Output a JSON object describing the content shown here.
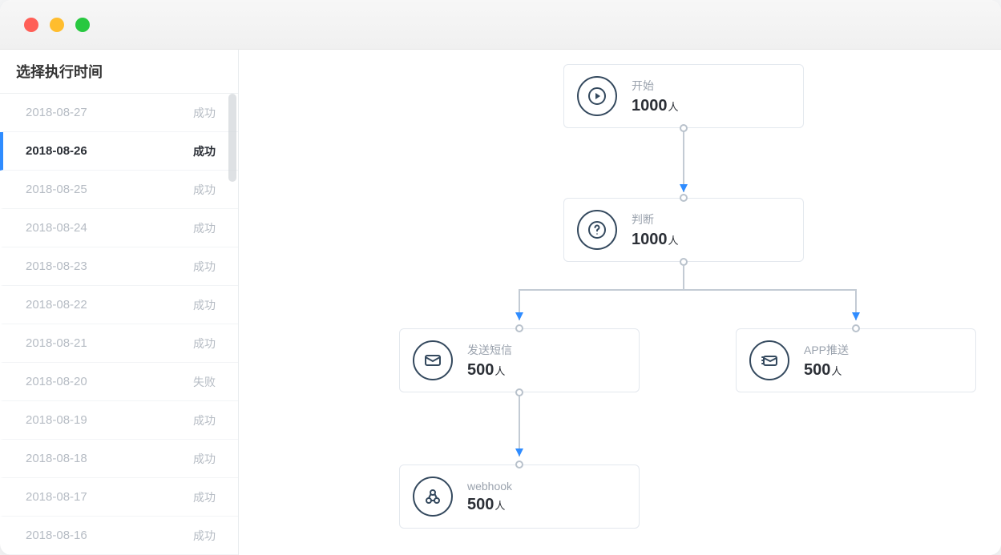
{
  "sidebar": {
    "header": "选择执行时间",
    "status_success": "成功",
    "status_fail": "失败",
    "items": [
      {
        "date": "2018-08-27",
        "status": "成功",
        "selected": false
      },
      {
        "date": "2018-08-26",
        "status": "成功",
        "selected": true
      },
      {
        "date": "2018-08-25",
        "status": "成功",
        "selected": false
      },
      {
        "date": "2018-08-24",
        "status": "成功",
        "selected": false
      },
      {
        "date": "2018-08-23",
        "status": "成功",
        "selected": false
      },
      {
        "date": "2018-08-22",
        "status": "成功",
        "selected": false
      },
      {
        "date": "2018-08-21",
        "status": "成功",
        "selected": false
      },
      {
        "date": "2018-08-20",
        "status": "失败",
        "selected": false
      },
      {
        "date": "2018-08-19",
        "status": "成功",
        "selected": false
      },
      {
        "date": "2018-08-18",
        "status": "成功",
        "selected": false
      },
      {
        "date": "2018-08-17",
        "status": "成功",
        "selected": false
      },
      {
        "date": "2018-08-16",
        "status": "成功",
        "selected": false
      }
    ]
  },
  "flow": {
    "unit": "人",
    "nodes": {
      "start": {
        "title": "开始",
        "count": "1000",
        "icon": "play"
      },
      "judge": {
        "title": "判断",
        "count": "1000",
        "icon": "question"
      },
      "sms": {
        "title": "发送短信",
        "count": "500",
        "icon": "mail"
      },
      "push": {
        "title": "APP推送",
        "count": "500",
        "icon": "send"
      },
      "webhook": {
        "title": "webhook",
        "count": "500",
        "icon": "webhook"
      }
    }
  }
}
